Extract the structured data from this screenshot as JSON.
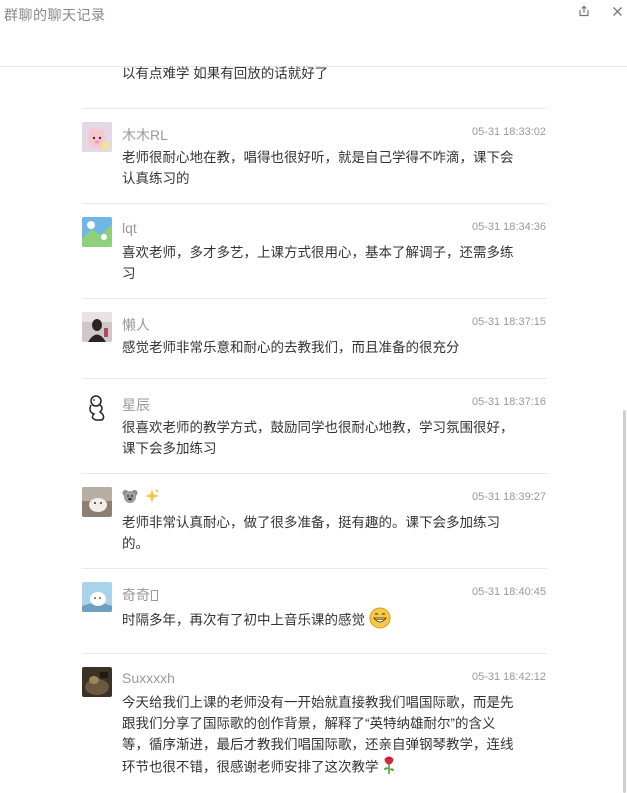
{
  "window": {
    "title": "群聊的聊天记录"
  },
  "messages": [
    {
      "name": "",
      "time": "",
      "text": "以有点难学 如果有回放的话就好了"
    },
    {
      "name": "木木RL",
      "time": "05-31 18:33:02",
      "text": "老师很耐心地在教，唱得也很好听，就是自己学得不咋滴，课下会认真练习的"
    },
    {
      "name": "lqt",
      "time": "05-31 18:34:36",
      "text": "喜欢老师，多才多艺，上课方式很用心，基本了解调子，还需多练习"
    },
    {
      "name": "懒人",
      "time": "05-31 18:37:15",
      "text": "感觉老师非常乐意和耐心的去教我们，而且准备的很充分"
    },
    {
      "name": "星辰",
      "time": "05-31 18:37:16",
      "text": "很喜欢老师的教学方式，鼓励同学也很耐心地教，学习氛围很好，课下会多加练习"
    },
    {
      "name": "",
      "time": "05-31 18:39:27",
      "text": "老师非常认真耐心，做了很多准备，挺有趣的。课下会多加练习的。"
    },
    {
      "name": "奇奇",
      "time": "05-31 18:40:45",
      "text": "时隔多年，再次有了初中上音乐课的感觉"
    },
    {
      "name": "Suxxxxh",
      "time": "05-31 18:42:12",
      "text": "今天给我们上课的老师没有一开始就直接教我们唱国际歌，而是先跟我们分享了国际歌的创作背景，解释了“英特纳雄耐尔”的含义等，循序渐进，最后才教我们唱国际歌，还亲自弹钢琴教学，连线环节也很不错，很感谢老师安排了这次教学"
    }
  ],
  "icons": {
    "share": "share-icon",
    "close": "close-icon",
    "koala": "koala-emoji-icon",
    "sparkle": "sparkle-emoji-icon",
    "grin": "grinning-emoji-icon",
    "rose": "rose-emoji-icon",
    "missing_glyph": "missing-glyph-icon"
  }
}
